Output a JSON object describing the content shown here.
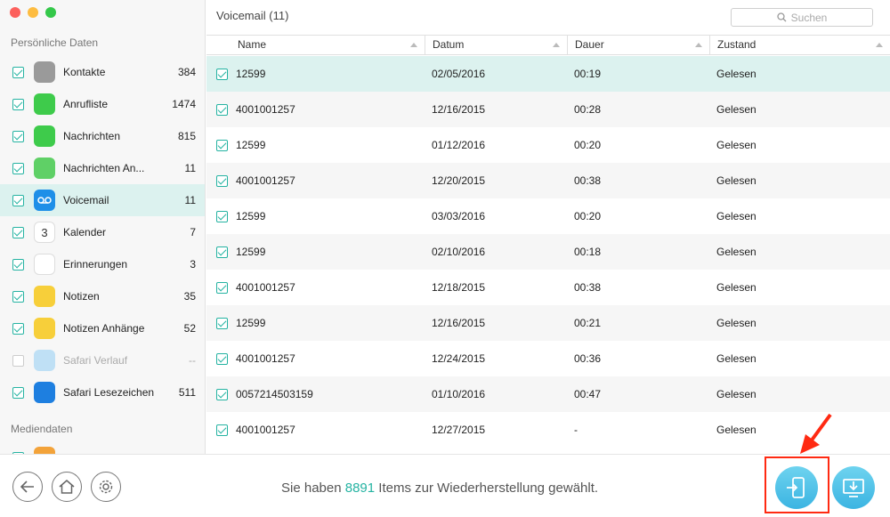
{
  "sidebar": {
    "section_personal": "Persönliche Daten",
    "section_media": "Mediendaten",
    "categories": [
      {
        "label": "Kontakte",
        "count": "384",
        "icon": "contacts-icon",
        "color": "#9a9a9a"
      },
      {
        "label": "Anrufliste",
        "count": "1474",
        "icon": "phone-icon",
        "color": "#3ecb4b"
      },
      {
        "label": "Nachrichten",
        "count": "815",
        "icon": "messages-icon",
        "color": "#3ecb4b"
      },
      {
        "label": "Nachrichten An...",
        "count": "11",
        "icon": "message-attachment-icon",
        "color": "#5fd066"
      },
      {
        "label": "Voicemail",
        "count": "11",
        "icon": "voicemail-icon",
        "color": "#1e8fe8"
      },
      {
        "label": "Kalender",
        "count": "7",
        "icon": "calendar-icon",
        "color": "#ffffff"
      },
      {
        "label": "Erinnerungen",
        "count": "3",
        "icon": "reminders-icon",
        "color": "#ffffff"
      },
      {
        "label": "Notizen",
        "count": "35",
        "icon": "notes-icon",
        "color": "#f7cf3a"
      },
      {
        "label": "Notizen Anhänge",
        "count": "52",
        "icon": "notes-attachment-icon",
        "color": "#f7cf3a"
      },
      {
        "label": "Safari Verlauf",
        "count": "--",
        "icon": "safari-history-icon",
        "color": "#bfe0f5"
      },
      {
        "label": "Safari Lesezeichen",
        "count": "511",
        "icon": "safari-bookmarks-icon",
        "color": "#1e7fe0"
      }
    ],
    "calendar_day": "3"
  },
  "main": {
    "title": "Voicemail (11)",
    "search_placeholder": "Suchen",
    "columns": [
      "Name",
      "Datum",
      "Dauer",
      "Zustand"
    ],
    "rows": [
      {
        "name": "12599",
        "date": "02/05/2016",
        "duration": "00:19",
        "state": "Gelesen"
      },
      {
        "name": "4001001257",
        "date": "12/16/2015",
        "duration": "00:28",
        "state": "Gelesen"
      },
      {
        "name": "12599",
        "date": "01/12/2016",
        "duration": "00:20",
        "state": "Gelesen"
      },
      {
        "name": "4001001257",
        "date": "12/20/2015",
        "duration": "00:38",
        "state": "Gelesen"
      },
      {
        "name": "12599",
        "date": "03/03/2016",
        "duration": "00:20",
        "state": "Gelesen"
      },
      {
        "name": "12599",
        "date": "02/10/2016",
        "duration": "00:18",
        "state": "Gelesen"
      },
      {
        "name": "4001001257",
        "date": "12/18/2015",
        "duration": "00:38",
        "state": "Gelesen"
      },
      {
        "name": "12599",
        "date": "12/16/2015",
        "duration": "00:21",
        "state": "Gelesen"
      },
      {
        "name": "4001001257",
        "date": "12/24/2015",
        "duration": "00:36",
        "state": "Gelesen"
      },
      {
        "name": "0057214503159",
        "date": "01/10/2016",
        "duration": "00:47",
        "state": "Gelesen"
      },
      {
        "name": "4001001257",
        "date": "12/27/2015",
        "duration": "-",
        "state": "Gelesen"
      }
    ]
  },
  "footer": {
    "status_prefix": "Sie haben",
    "status_count": "8891",
    "status_suffix": "Items zur Wiederherstellung gewählt.",
    "accent": "#25b3a2"
  }
}
